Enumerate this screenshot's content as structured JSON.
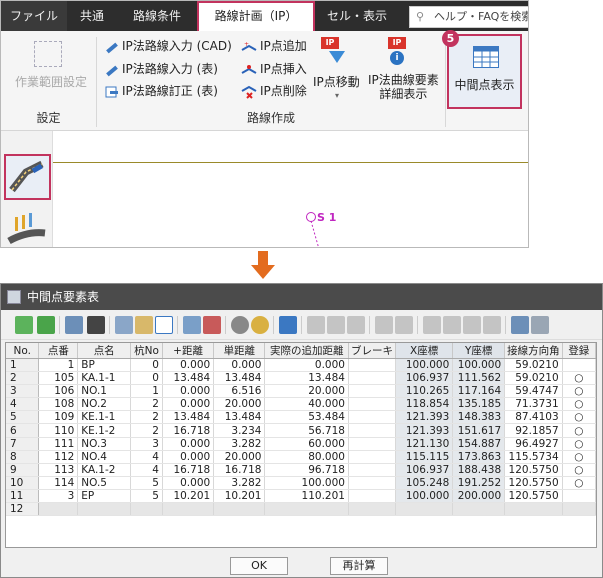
{
  "ribbon": {
    "tabs": [
      "ファイル",
      "共通",
      "路線条件",
      "路線計画（IP）",
      "セル・表示"
    ],
    "help_placeholder": "ヘルプ・FAQを検索",
    "settings_button": "作業範囲設定",
    "ip_input_cad": "IP法路線入力 (CAD)",
    "ip_input_table": "IP法路線入力 (表)",
    "ip_revise_table": "IP法路線訂正 (表)",
    "ip_point_add": "IP点追加",
    "ip_point_insert": "IP点挿入",
    "ip_point_delete": "IP点削除",
    "ip_point_move": "IP点移動",
    "ip_curve_line1": "IP法曲線要素",
    "ip_curve_line2": "詳細表示",
    "midpoint_display": "中間点表示",
    "group_settings": "設定",
    "group_route": "路線作成",
    "step_badge": "5"
  },
  "canvas": {
    "point_label": "S 1"
  },
  "window": {
    "title": "中間点要素表",
    "ok_button": "OK",
    "recalc_button": "再計算"
  },
  "table": {
    "headers": [
      "No.",
      "点番",
      "点名",
      "杭No",
      "+距離",
      "単距離",
      "実際の追加距離",
      "ブレーキ",
      "X座標",
      "Y座標",
      "接線方向角",
      "登録"
    ],
    "rows": [
      [
        "1",
        "1",
        "BP",
        "0",
        "0.000",
        "0.000",
        "0.000",
        "",
        "100.000",
        "100.000",
        "59.0210",
        ""
      ],
      [
        "2",
        "105",
        "KA.1-1",
        "0",
        "13.484",
        "13.484",
        "13.484",
        "",
        "106.937",
        "111.562",
        "59.0210",
        "○"
      ],
      [
        "3",
        "106",
        "NO.1",
        "1",
        "0.000",
        "6.516",
        "20.000",
        "",
        "110.265",
        "117.164",
        "59.4747",
        "○"
      ],
      [
        "4",
        "108",
        "NO.2",
        "2",
        "0.000",
        "20.000",
        "40.000",
        "",
        "118.854",
        "135.185",
        "71.3731",
        "○"
      ],
      [
        "5",
        "109",
        "KE.1-1",
        "2",
        "13.484",
        "13.484",
        "53.484",
        "",
        "121.393",
        "148.383",
        "87.4103",
        "○"
      ],
      [
        "6",
        "110",
        "KE.1-2",
        "2",
        "16.718",
        "3.234",
        "56.718",
        "",
        "121.393",
        "151.617",
        "92.1857",
        "○"
      ],
      [
        "7",
        "111",
        "NO.3",
        "3",
        "0.000",
        "3.282",
        "60.000",
        "",
        "121.130",
        "154.887",
        "96.4927",
        "○"
      ],
      [
        "8",
        "112",
        "NO.4",
        "4",
        "0.000",
        "20.000",
        "80.000",
        "",
        "115.115",
        "173.863",
        "115.5734",
        "○"
      ],
      [
        "9",
        "113",
        "KA.1-2",
        "4",
        "16.718",
        "16.718",
        "96.718",
        "",
        "106.937",
        "188.438",
        "120.5750",
        "○"
      ],
      [
        "10",
        "114",
        "NO.5",
        "5",
        "0.000",
        "3.282",
        "100.000",
        "",
        "105.248",
        "191.252",
        "120.5750",
        "○"
      ],
      [
        "11",
        "3",
        "EP",
        "5",
        "10.201",
        "10.201",
        "110.201",
        "",
        "100.000",
        "200.000",
        "120.5750",
        ""
      ],
      [
        "12",
        "",
        "",
        "",
        "",
        "",
        "",
        "",
        "",
        "",
        "",
        ""
      ]
    ]
  },
  "colors": {
    "accent": "#c2335e",
    "arrow": "#e36c1f",
    "tabbar": "#2d2d2d",
    "curve": "#9a8a2a",
    "marker": "#c026c0"
  }
}
